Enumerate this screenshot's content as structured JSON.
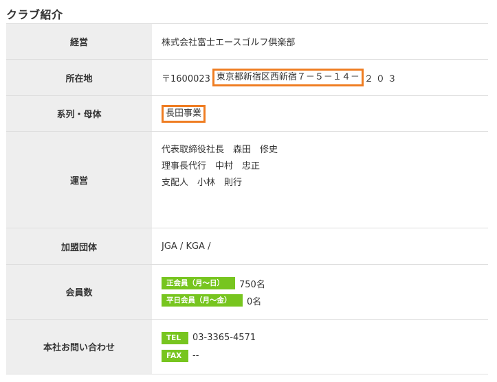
{
  "title": "クラブ紹介",
  "rows": {
    "operator": {
      "label": "経営",
      "value": "株式会社富士エースゴルフ倶楽部"
    },
    "address": {
      "label": "所在地",
      "zip": "〒1600023",
      "highlighted": "東京都新宿区西新宿７－５－１４－",
      "rest": "２０３"
    },
    "affiliation": {
      "label": "系列・母体",
      "value": "長田事業"
    },
    "management": {
      "label": "運営",
      "lines": [
        "代表取締役社長　森田　修史",
        "理事長代行　中村　忠正",
        "支配人　小林　則行"
      ]
    },
    "associations": {
      "label": "加盟団体",
      "value": "JGA / KGA /"
    },
    "members": {
      "label": "会員数",
      "regular_badge": "正会員（月～日）",
      "regular_count": "750名",
      "weekday_badge": "平日会員（月～金）",
      "weekday_count": "0名"
    },
    "contact": {
      "label": "本社お問い合わせ",
      "tel_badge": "TEL",
      "tel": "03-3365-4571",
      "fax_badge": "FAX",
      "fax": "--"
    }
  },
  "colors": {
    "highlight_border": "#ef7d22",
    "badge_green": "#77c51f",
    "header_bg": "#eeeeee"
  }
}
